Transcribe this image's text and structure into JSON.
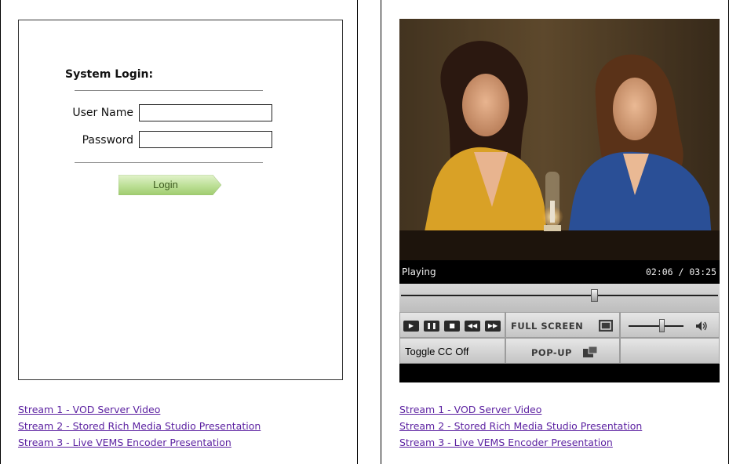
{
  "login": {
    "title": "System Login:",
    "username_label": "User Name",
    "password_label": "Password",
    "username_value": "",
    "password_value": "",
    "button_label": "Login"
  },
  "left_links": [
    "Stream 1 - VOD Server Video",
    "Stream 2 - Stored Rich Media Studio Presentation",
    "Stream 3 - Live VEMS Encoder Presentation"
  ],
  "right_links": [
    "Stream 1 - VOD Server Video",
    "Stream 2 - Stored Rich Media Studio Presentation",
    "Stream 3 - Live VEMS Encoder Presentation"
  ],
  "player": {
    "status": "Playing",
    "time": "02:06 / 03:25",
    "progress_fraction": 0.61,
    "volume_fraction": 0.6,
    "fullscreen_label": "FULL SCREEN",
    "popup_label": "POP-UP",
    "cc_label": "Toggle CC Off"
  },
  "colors": {
    "link": "#5a1fa0",
    "login_button": "#b8dc8c",
    "player_background": "#0a0a0a"
  }
}
